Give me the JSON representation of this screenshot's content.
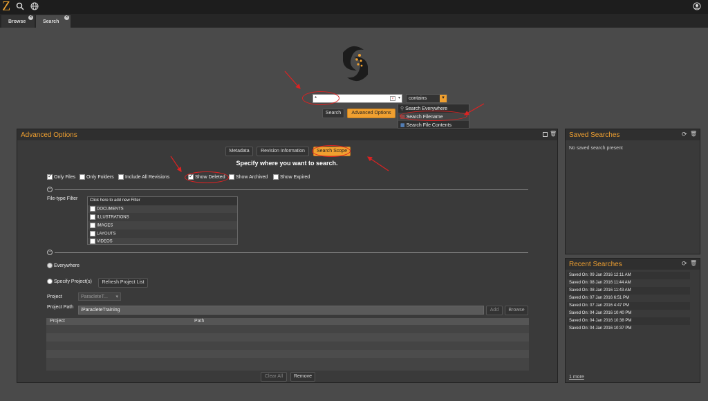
{
  "header": {
    "logo": "Z"
  },
  "tabs": [
    {
      "label": "Browse"
    },
    {
      "label": "Search"
    }
  ],
  "search": {
    "input_value": "*",
    "operator": "contains",
    "search_label": "Search",
    "advanced_label": "Advanced Options",
    "scope_options": [
      {
        "label": "Search Everywhere"
      },
      {
        "label": "Search Filename"
      },
      {
        "label": "Search File Contents"
      }
    ]
  },
  "advanced": {
    "title": "Advanced Options",
    "tabs": [
      "Metadata",
      "Revision Information",
      "Search Scope"
    ],
    "heading": "Specify where you want to search.",
    "checks": {
      "only_files": "Only Files",
      "only_folders": "Only Folders",
      "include_all_revisions": "Include All Revisions",
      "show_deleted": "Show Deleted",
      "show_archived": "Show Archived",
      "show_expired": "Show Expired"
    },
    "filetype_label": "File-type Filter",
    "filetype_header": "Click here to add new Filter",
    "filetypes": [
      "DOCUMENTS",
      "ILLUSTRATIONS",
      "IMAGES",
      "LAYOUTS",
      "VIDEOS"
    ],
    "everywhere": "Everywhere",
    "specify_projects": "Specify Project(s)",
    "refresh": "Refresh Project List",
    "project_label": "Project",
    "project_value": "ParacleteT...",
    "path_label": "Project Path",
    "path_value": "/ParacleteTraining",
    "add": "Add",
    "browse": "Browse",
    "table_cols": [
      "Project",
      "Path"
    ],
    "clear_all": "Clear All",
    "remove": "Remove"
  },
  "saved": {
    "title": "Saved Searches",
    "empty": "No saved search present"
  },
  "recent": {
    "title": "Recent Searches",
    "items": [
      "Saved On: 09 Jan 2016 12:11 AM",
      "Saved On: 08 Jan 2016 11:44 AM",
      "Saved On: 08 Jan 2016 11:43 AM",
      "Saved On: 07 Jan 2016 6:51 PM",
      "Saved On: 07 Jan 2016 4:47 PM",
      "Saved On: 04 Jan 2016 10:40 PM",
      "Saved On: 04 Jan 2016 10:38 PM",
      "Saved On: 04 Jan 2016 10:37 PM"
    ],
    "more": "1 more"
  },
  "colors": {
    "accent": "#f0a030",
    "annotation": "#dd2222"
  }
}
